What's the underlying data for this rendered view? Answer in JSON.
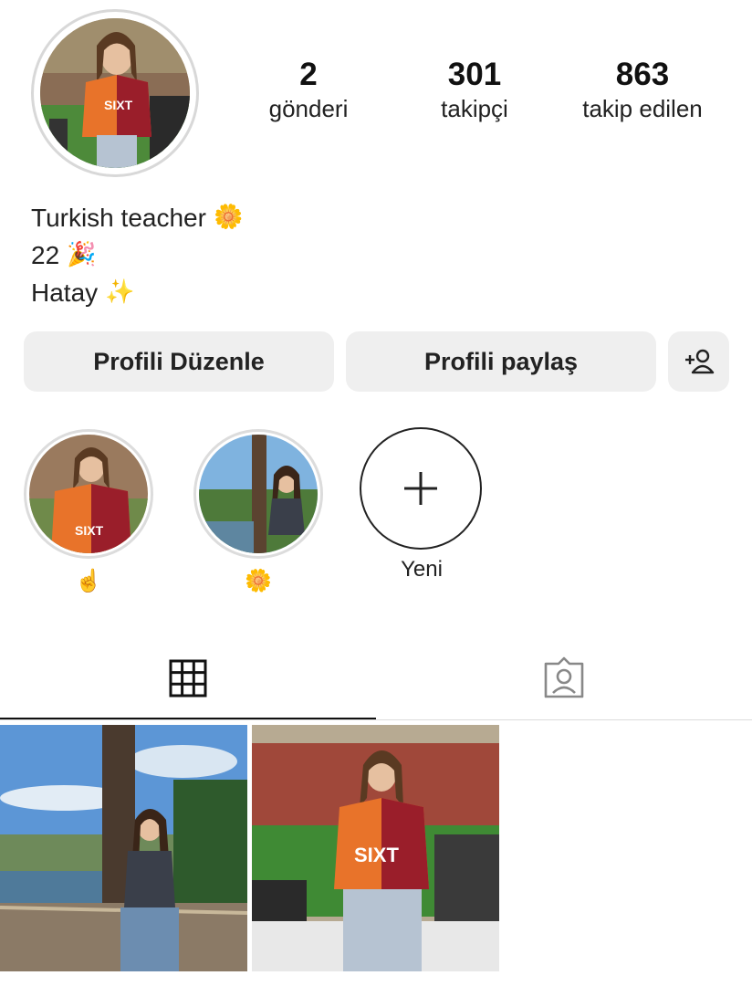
{
  "profile": {
    "stats": [
      {
        "value": "2",
        "label": "gönderi"
      },
      {
        "value": "301",
        "label": "takipçi"
      },
      {
        "value": "863",
        "label": "takip edilen"
      }
    ],
    "bio": [
      {
        "text": "Turkish teacher",
        "emoji": "🌼"
      },
      {
        "text": "22",
        "emoji": "🎉"
      },
      {
        "text": "Hatay",
        "emoji": "✨"
      }
    ]
  },
  "actions": {
    "edit_label": "Profili Düzenle",
    "share_label": "Profili paylaş",
    "add_person_icon": "add-person-icon"
  },
  "highlights": [
    {
      "label": "☝️",
      "icon": "photo"
    },
    {
      "label": "🌼",
      "icon": "photo"
    },
    {
      "label": "Yeni",
      "icon": "plus-icon"
    }
  ],
  "tabs": [
    {
      "icon": "grid-icon",
      "active": true
    },
    {
      "icon": "tagged-person-icon",
      "active": false
    }
  ],
  "posts": [
    {
      "alt": "post-1"
    },
    {
      "alt": "post-2"
    }
  ],
  "colors": {
    "button_bg": "#efefef",
    "text": "#111111",
    "divider": "#dbdbdb"
  }
}
